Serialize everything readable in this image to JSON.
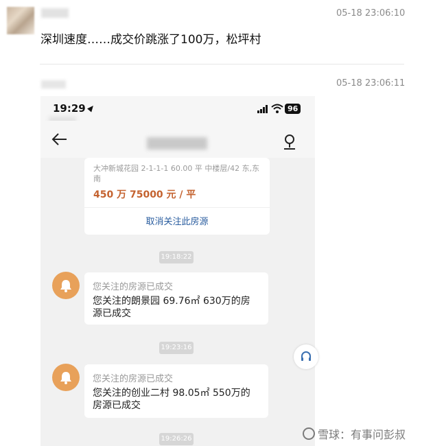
{
  "messages": [
    {
      "timestamp": "05-18 23:06:10",
      "text": "深圳速度……成交价跳涨了100万，松坪村"
    },
    {
      "timestamp": "05-18 23:06:11"
    }
  ],
  "phone": {
    "status_time": "19:29",
    "battery": "96",
    "card": {
      "address": "大冲新城花园 2-1-1-1 60.00 平 中楼层/42 东,东南",
      "price": "450 万 75000 元 / 平",
      "unfollow_label": "取消关注此房源"
    },
    "timestamps": [
      "19:18:22",
      "19:23:16",
      "19:26:26"
    ],
    "notices": [
      {
        "title": "您关注的房源已成交",
        "body": "您关注的朗景园 69.76㎡ 630万的房源已成交"
      },
      {
        "title": "您关注的房源已成交",
        "body": "您关注的创业二村 98.05㎡ 550万的房源已成交"
      }
    ]
  },
  "watermark": "雪球：有事问彭叔"
}
